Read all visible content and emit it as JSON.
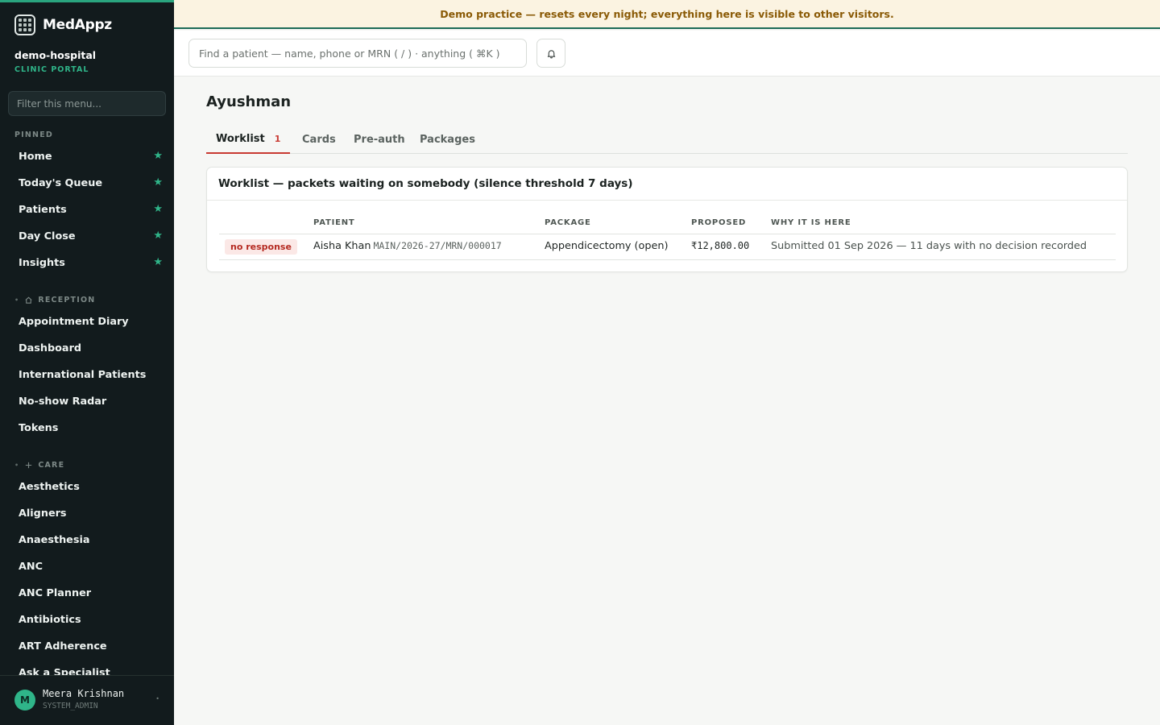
{
  "app": {
    "name": "MedAppz",
    "org": "demo-hospital",
    "portal": "CLINIC PORTAL"
  },
  "banner": "Demo practice — resets every night; everything here is visible to other visitors.",
  "sidebar": {
    "filter_placeholder": "Filter this menu...",
    "pinned_label": "PINNED",
    "pinned": [
      {
        "label": "Home"
      },
      {
        "label": "Today's Queue"
      },
      {
        "label": "Patients"
      },
      {
        "label": "Day Close"
      },
      {
        "label": "Insights"
      }
    ],
    "reception_label": "RECEPTION",
    "reception": [
      {
        "label": "Appointment Diary"
      },
      {
        "label": "Dashboard"
      },
      {
        "label": "International Patients"
      },
      {
        "label": "No-show Radar"
      },
      {
        "label": "Tokens"
      }
    ],
    "care_label": "CARE",
    "care": [
      {
        "label": "Aesthetics"
      },
      {
        "label": "Aligners"
      },
      {
        "label": "Anaesthesia"
      },
      {
        "label": "ANC"
      },
      {
        "label": "ANC Planner"
      },
      {
        "label": "Antibiotics"
      },
      {
        "label": "ART Adherence"
      },
      {
        "label": "Ask a Specialist"
      }
    ],
    "user": {
      "initial": "M",
      "name": "Meera Krishnan",
      "role": "SYSTEM_ADMIN"
    }
  },
  "topbar": {
    "search_placeholder": "Find a patient — name, phone or MRN ( / ) · anything ( ⌘K )"
  },
  "page": {
    "title": "Ayushman",
    "tabs": [
      {
        "label": "Worklist",
        "badge": "1"
      },
      {
        "label": "Cards"
      },
      {
        "label": "Pre-auth"
      },
      {
        "label": "Packages"
      }
    ],
    "worklist": {
      "title": "Worklist — packets waiting on somebody (silence threshold 7 days)",
      "columns": [
        "",
        "PATIENT",
        "PACKAGE",
        "PROPOSED",
        "WHY IT IS HERE"
      ],
      "rows": [
        {
          "status": "no response",
          "patient": "Aisha Khan",
          "mrn": "MAIN/2026-27/MRN/000017",
          "package": "Appendicectomy (open)",
          "proposed": "₹12,800.00",
          "reason": "Submitted 01 Sep 2026 — 11 days with no decision recorded"
        }
      ]
    }
  }
}
